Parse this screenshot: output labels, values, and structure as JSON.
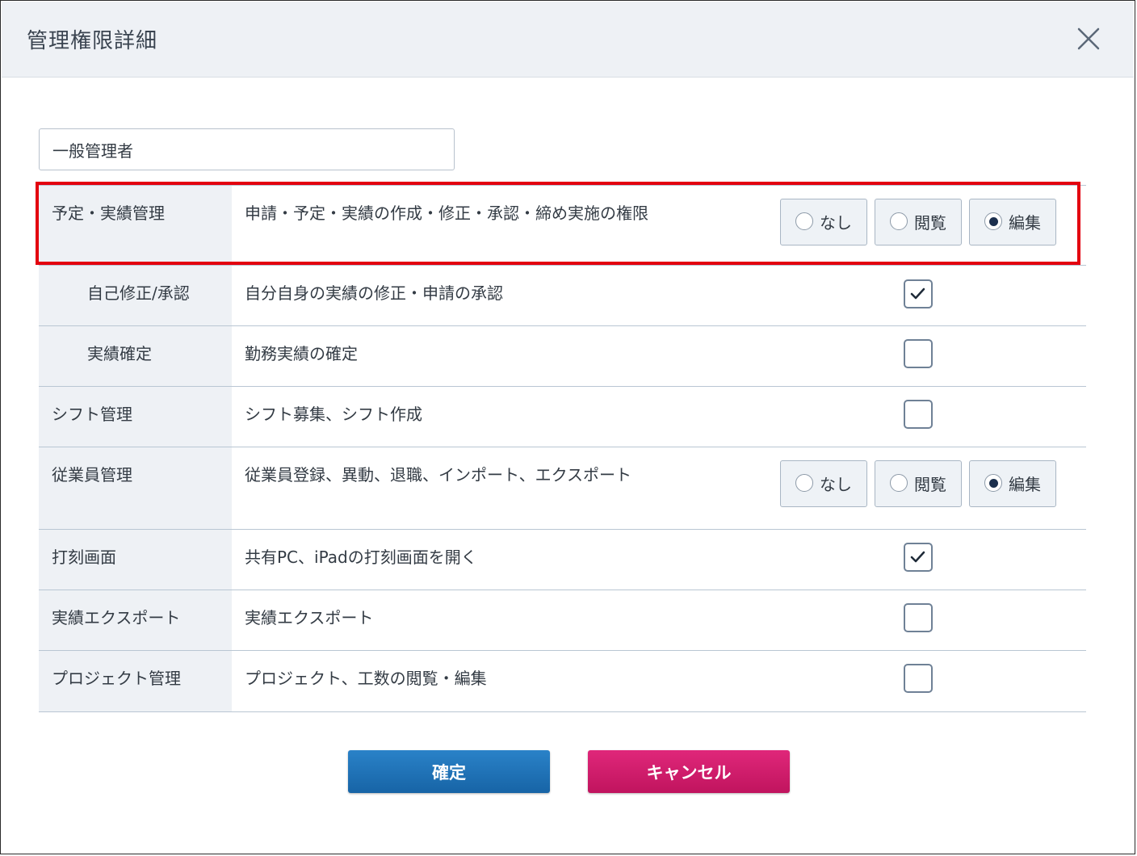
{
  "dialog": {
    "title": "管理権限詳細",
    "close_icon": "close-icon"
  },
  "role_name": {
    "value": "一般管理者"
  },
  "options": {
    "none": "なし",
    "view": "閲覧",
    "edit": "編集"
  },
  "permissions": [
    {
      "label": "予定・実績管理",
      "description": "申請・予定・実績の作成・修正・承認・締め実施の権限",
      "control": "radio",
      "selected": "edit"
    },
    {
      "label": "自己修正/承認",
      "description": "自分自身の実績の修正・申請の承認",
      "control": "checkbox",
      "checked": true
    },
    {
      "label": "実績確定",
      "description": "勤務実績の確定",
      "control": "checkbox",
      "checked": false
    },
    {
      "label": "シフト管理",
      "description": "シフト募集、シフト作成",
      "control": "checkbox",
      "checked": false
    },
    {
      "label": "従業員管理",
      "description": "従業員登録、異動、退職、インポート、エクスポート",
      "control": "radio",
      "selected": "edit"
    },
    {
      "label": "打刻画面",
      "description": "共有PC、iPadの打刻画面を開く",
      "control": "checkbox",
      "checked": true
    },
    {
      "label": "実績エクスポート",
      "description": "実績エクスポート",
      "control": "checkbox",
      "checked": false
    },
    {
      "label": "プロジェクト管理",
      "description": "プロジェクト、工数の閲覧・編集",
      "control": "checkbox",
      "checked": false
    }
  ],
  "footer": {
    "confirm_label": "確定",
    "cancel_label": "キャンセル"
  },
  "colors": {
    "highlight_border": "#e3000f",
    "confirm_button": "#1f72b8",
    "cancel_button": "#d21c6c",
    "label_cell_bg": "#eef1f5"
  }
}
